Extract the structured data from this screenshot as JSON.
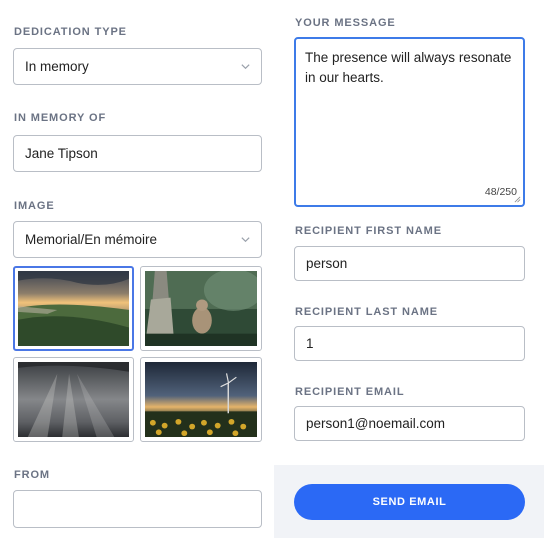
{
  "left": {
    "dedication_type": {
      "label": "DEDICATION TYPE",
      "value": "In memory"
    },
    "in_memory_of": {
      "label": "IN MEMORY OF",
      "value": "Jane Tipson"
    },
    "image": {
      "label": "IMAGE",
      "value": "Memorial/En mémoire",
      "thumbnails": [
        "coastal-sunset",
        "cougar-in-forest",
        "sun-rays-over-sea",
        "wind-turbine-sunflowers"
      ],
      "selected_index": 0
    },
    "from": {
      "label": "FROM",
      "value": ""
    }
  },
  "right": {
    "message": {
      "label": "YOUR MESSAGE",
      "value": "The presence will always resonate in our hearts.",
      "counter": "48/250"
    },
    "first_name": {
      "label": "RECIPIENT FIRST NAME",
      "value": "person"
    },
    "last_name": {
      "label": "RECIPIENT LAST NAME",
      "value": "1"
    },
    "email": {
      "label": "RECIPIENT EMAIL",
      "value": "person1@noemail.com"
    },
    "send_button": "SEND EMAIL"
  },
  "colors": {
    "accent": "#2b69f5",
    "focus_border": "#3d7be8",
    "label": "#6b7384",
    "panel": "#f1f3f7"
  }
}
